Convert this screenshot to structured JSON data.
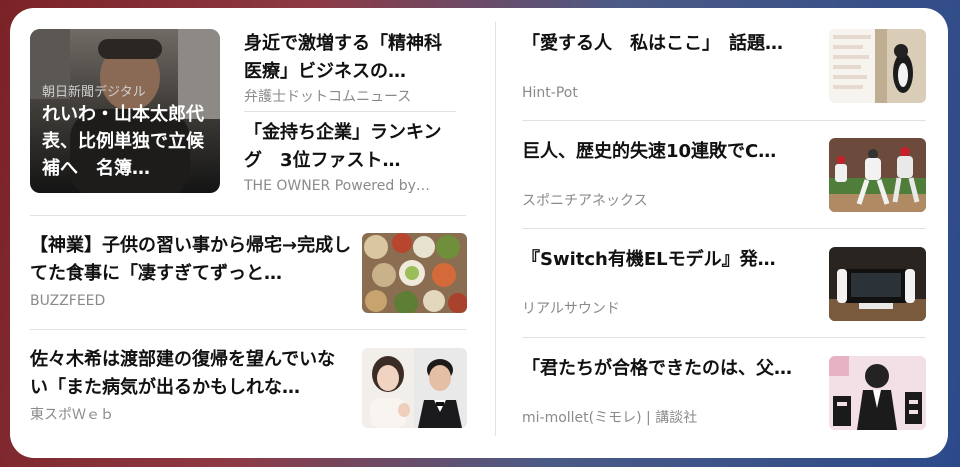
{
  "hero": {
    "source": "朝日新聞デジタル",
    "title": "れいわ・山本太郎代表、比例単独で立候補へ　名簿…"
  },
  "left_column": {
    "small_stories": [
      {
        "title": "身近で激増する「精神科医療」ビジネスの…",
        "source": "弁護士ドットコムニュース"
      },
      {
        "title": "「金持ち企業」ランキング　3位ファスト…",
        "source": "THE OWNER Powered by…"
      }
    ],
    "stories": [
      {
        "title": "【神業】子供の習い事から帰宅→完成してた食事に「凄すぎてずっと…",
        "source": "BUZZFEED",
        "thumb_icon": "food-photo-icon"
      },
      {
        "title": "佐々木希は渡部建の復帰を望んでいない「また病気が出るかもしれな…",
        "source": "東スポＷｅｂ",
        "thumb_icon": "portrait-photo-icon"
      }
    ]
  },
  "right_column": {
    "stories": [
      {
        "title": "「愛する人　私はここ」　話題…",
        "source": "Hint-Pot",
        "thumb_icon": "cat-photo-icon"
      },
      {
        "title": "巨人、歴史的失速10連敗でC…",
        "source": "スポニチアネックス",
        "thumb_icon": "baseball-photo-icon"
      },
      {
        "title": "『Switch有機ELモデル』発…",
        "source": "リアルサウンド",
        "thumb_icon": "console-photo-icon"
      },
      {
        "title": "「君たちが合格できたのは、父…",
        "source": "mi-mollet(ミモレ) | 講談社",
        "thumb_icon": "manga-photo-icon"
      }
    ]
  },
  "colors": {
    "card": "#ffffff",
    "title": "#111111",
    "source": "#8a8a8a",
    "divider": "#e2e2e2"
  }
}
